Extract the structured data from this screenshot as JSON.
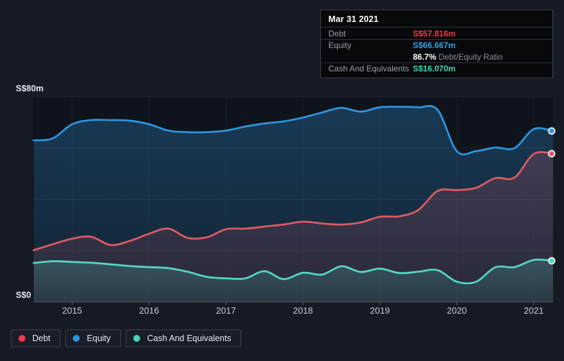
{
  "tooltip": {
    "date": "Mar 31 2021",
    "rows": [
      {
        "label": "Debt",
        "value": "S$57.816m"
      },
      {
        "label": "Equity",
        "value": "S$66.667m"
      },
      {
        "label": "Cash And Equivalents",
        "value": "S$16.070m"
      }
    ],
    "ratio_bold": "86.7%",
    "ratio_rest": " Debt/Equity Ratio"
  },
  "axis": {
    "y_max_label": "S$80m",
    "y_min_label": "S$0"
  },
  "legend": [
    {
      "label": "Debt"
    },
    {
      "label": "Equity"
    },
    {
      "label": "Cash And Equivalents"
    }
  ],
  "colors": {
    "page_bg": "#161a25",
    "plot_bg": "#0f131b",
    "grid": "rgba(255,255,255,0.07)",
    "grid_vertical": "rgba(255,255,255,0.04)",
    "axis_line": "#545964",
    "tick_label": "#c9ccd2",
    "y_label": "#e3e6ea",
    "debt": "#db5a64",
    "debt_accent": "#ef3b49",
    "equity": "#2d94dd",
    "equity_accent": "#389fe3",
    "cash": "#53d6bf",
    "cash_accent": "#43d4b7",
    "dot_ring": "#dce4eb",
    "tooltip_bg": "#08090c"
  },
  "chart_data": {
    "type": "area",
    "title": "Debt / Equity / Cash history",
    "x": [
      2014.5,
      2014.75,
      2015.0,
      2015.25,
      2015.5,
      2015.75,
      2016.0,
      2016.25,
      2016.5,
      2016.75,
      2017.0,
      2017.25,
      2017.5,
      2017.75,
      2018.0,
      2018.25,
      2018.5,
      2018.75,
      2019.0,
      2019.25,
      2019.5,
      2019.75,
      2020.0,
      2020.25,
      2020.5,
      2020.75,
      2021.0,
      2021.25
    ],
    "x_tick_values": [
      2015,
      2016,
      2017,
      2018,
      2019,
      2020,
      2021
    ],
    "x_tick_labels": [
      "2015",
      "2016",
      "2017",
      "2018",
      "2019",
      "2020",
      "2021"
    ],
    "ylim": [
      0,
      80
    ],
    "y_gridline_values": [
      20,
      40,
      60,
      80
    ],
    "y_unit": "S$m",
    "grid": true,
    "legend_position": "bottom-left",
    "series": [
      {
        "name": "Debt",
        "values": [
          20.2,
          22.5,
          24.7,
          25.4,
          22.2,
          23.8,
          26.6,
          28.6,
          25.0,
          25.2,
          28.4,
          28.6,
          29.4,
          30.2,
          31.3,
          30.6,
          30.2,
          31.0,
          33.2,
          33.4,
          35.9,
          43.3,
          43.6,
          44.5,
          48.3,
          48.5,
          57.7,
          57.816
        ]
      },
      {
        "name": "Equity",
        "values": [
          63.0,
          63.8,
          69.3,
          70.9,
          70.9,
          70.7,
          69.3,
          66.8,
          66.2,
          66.2,
          66.8,
          68.4,
          69.6,
          70.4,
          71.9,
          73.9,
          75.7,
          74.2,
          75.9,
          76.1,
          75.9,
          74.9,
          58.8,
          58.8,
          60.2,
          60.0,
          67.4,
          66.667
        ]
      },
      {
        "name": "Cash And Equivalents",
        "values": [
          15.2,
          15.9,
          15.6,
          15.3,
          14.7,
          14.0,
          13.6,
          13.2,
          11.8,
          9.8,
          9.2,
          9.2,
          12.0,
          8.9,
          11.4,
          10.7,
          13.9,
          11.7,
          13.0,
          11.3,
          11.8,
          12.4,
          7.9,
          7.9,
          13.5,
          13.6,
          16.4,
          16.07
        ]
      }
    ]
  }
}
